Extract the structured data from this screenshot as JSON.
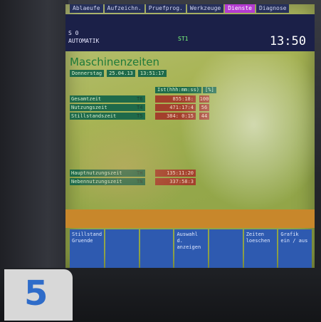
{
  "tabs": [
    "Ablaeufe",
    "Aufzeichn.",
    "Pruefprog.",
    "Werkzeuge",
    "Dienste",
    "Diagnose"
  ],
  "header": {
    "channel": "S 0",
    "mode": "AUTOMATIK",
    "station": "ST1",
    "clock": "13:50"
  },
  "title": "Maschinenzeiten",
  "date": {
    "weekday": "Donnerstag",
    "date": "25.04.13",
    "time": "13:51:17"
  },
  "column_headers": {
    "time": "Ist(hhh:mm:ss)",
    "pct": "[%]"
  },
  "group1": [
    {
      "label": "Gesamtzeit",
      "id": "T6",
      "value": "855:18:",
      "pct": "100"
    },
    {
      "label": "Nutzungszeit",
      "id": "T4",
      "value": "471:17:4",
      "pct": "56"
    },
    {
      "label": "Stillstandszeit",
      "id": "T5",
      "value": "384: 0:15",
      "pct": "44"
    }
  ],
  "group2": [
    {
      "label": "Hauptnutzungszeit",
      "id": "TH",
      "value": "135:11:20",
      "pct": ""
    },
    {
      "label": "Nebennutzungszeit",
      "id": "TN",
      "value": "337:58:3",
      "pct": ""
    }
  ],
  "softkeys": [
    {
      "label": "Stillstand\nGruende"
    },
    {
      "label": ""
    },
    {
      "label": ""
    },
    {
      "label": "Auswahl d.\nanzeigen"
    },
    {
      "label": ""
    },
    {
      "label": "Zeiten\nloeschen"
    },
    {
      "label": "Grafik\nein / aus"
    }
  ],
  "badge_number": "5"
}
